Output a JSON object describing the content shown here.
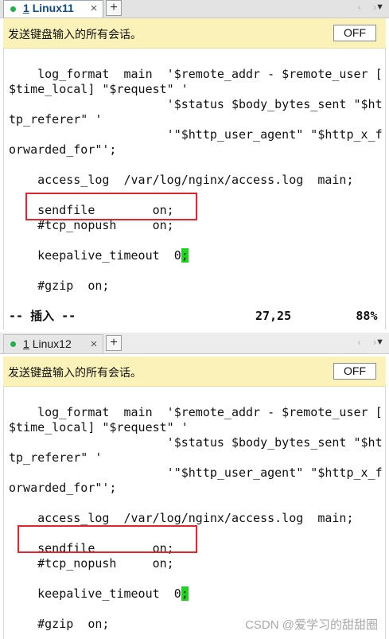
{
  "panes": [
    {
      "tab": {
        "number": "1",
        "name": "Linux11",
        "close": "×"
      },
      "new_tab": "+",
      "nav": {
        "arrows": "‹ ›",
        "menu": "▼"
      },
      "broadcast": {
        "message": "发送键盘输入的所有会话。",
        "button": "OFF"
      },
      "terminal": {
        "lines": [
          "    log_format  main  '$remote_addr - $remote_user [",
          "$time_local] \"$request\" '",
          "                      '$status $body_bytes_sent \"$ht",
          "tp_referer\" '",
          "                      '\"$http_user_agent\" \"$http_x_f",
          "orwarded_for\"';",
          "",
          "    access_log  /var/log/nginx/access.log  main;",
          "",
          "    sendfile        on;",
          "    #tcp_nopush     on;",
          "",
          "    keepalive_timeout  0",
          "",
          "    #gzip  on;",
          "",
          "-- 插入 --                         27,25         88%"
        ],
        "cursor_char": ";"
      }
    },
    {
      "tab": {
        "number": "1",
        "name": "Linux12",
        "close": "×"
      },
      "new_tab": "+",
      "nav": {
        "arrows": "‹ ›",
        "menu": "▼"
      },
      "broadcast": {
        "message": "发送键盘输入的所有会话。",
        "button": "OFF"
      },
      "terminal": {
        "lines": [
          "    log_format  main  '$remote_addr - $remote_user [",
          "$time_local] \"$request\" '",
          "                      '$status $body_bytes_sent \"$ht",
          "tp_referer\" '",
          "                      '\"$http_user_agent\" \"$http_x_f",
          "orwarded_for\"';",
          "",
          "    access_log  /var/log/nginx/access.log  main;",
          "",
          "    sendfile        on;",
          "    #tcp_nopush     on;",
          "",
          "    keepalive_timeout  0",
          "",
          "    #gzip  on;"
        ],
        "cursor_char": ";"
      }
    }
  ],
  "watermark": "CSDN @爱学习的甜甜圈"
}
